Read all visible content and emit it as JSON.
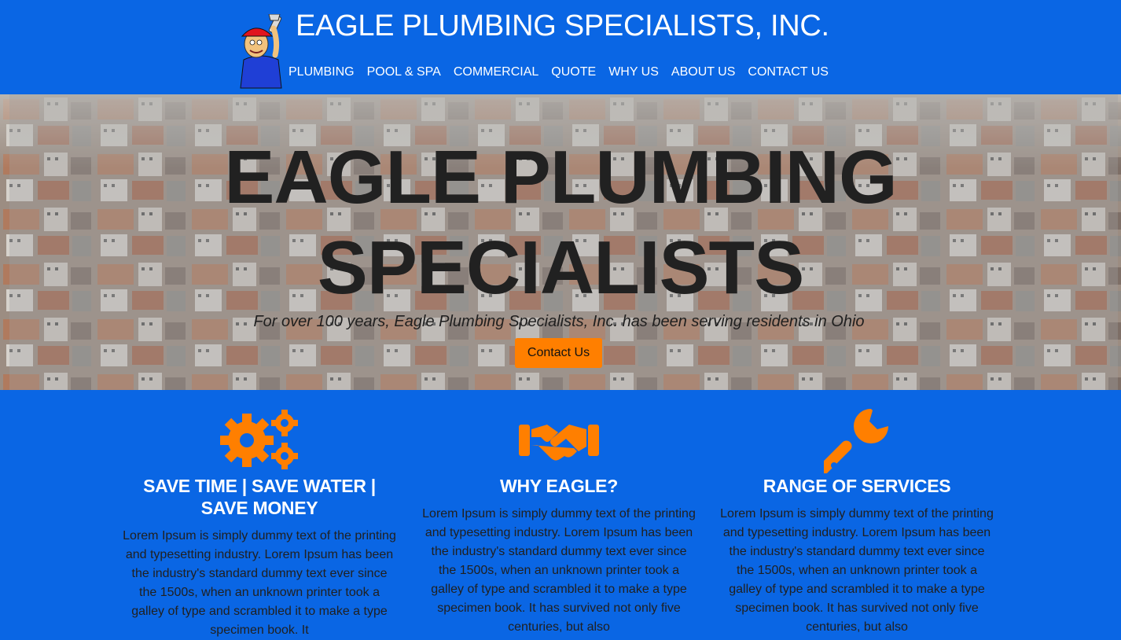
{
  "header": {
    "brand_title": "EAGLE PLUMBING SPECIALISTS, INC.",
    "logo_icon": "plumber-mascot-icon",
    "nav": [
      {
        "label": "PLUMBING"
      },
      {
        "label": "POOL & SPA"
      },
      {
        "label": "COMMERCIAL"
      },
      {
        "label": "QUOTE"
      },
      {
        "label": "WHY US"
      },
      {
        "label": "ABOUT US"
      },
      {
        "label": "CONTACT US"
      }
    ]
  },
  "hero": {
    "title_line1": "EAGLE PLUMBING",
    "title_line2": "SPECIALISTS",
    "tagline": "For over 100 years, Eagle Plumbing Specialists, Inc. has been serving residents in Ohio",
    "cta_label": "Contact Us",
    "background": "city-rooftops-image"
  },
  "features": [
    {
      "icon": "gears-icon",
      "title": "SAVE TIME | SAVE WATER | SAVE MONEY",
      "body": "Lorem Ipsum is simply dummy text of the printing and typesetting industry. Lorem Ipsum has been the industry's standard dummy text ever since the 1500s, when an unknown printer took a galley of type and scrambled it to make a type specimen book. It"
    },
    {
      "icon": "handshake-icon",
      "title": "WHY EAGLE?",
      "body": "Lorem Ipsum is simply dummy text of the printing and typesetting industry. Lorem Ipsum has been the industry's standard dummy text ever since the 1500s, when an unknown printer took a galley of type and scrambled it to make a type specimen book. It has survived not only five centuries, but also"
    },
    {
      "icon": "wrench-icon",
      "title": "RANGE OF SERVICES",
      "body": "Lorem Ipsum is simply dummy text of the printing and typesetting industry. Lorem Ipsum has been the industry's standard dummy text ever since the 1500s, when an unknown printer took a galley of type and scrambled it to make a type specimen book. It has survived not only five centuries, but also"
    }
  ],
  "colors": {
    "brand_blue": "#0a66e4",
    "accent_orange": "#ff7f00",
    "white": "#ffffff",
    "dark_text": "#212121"
  }
}
